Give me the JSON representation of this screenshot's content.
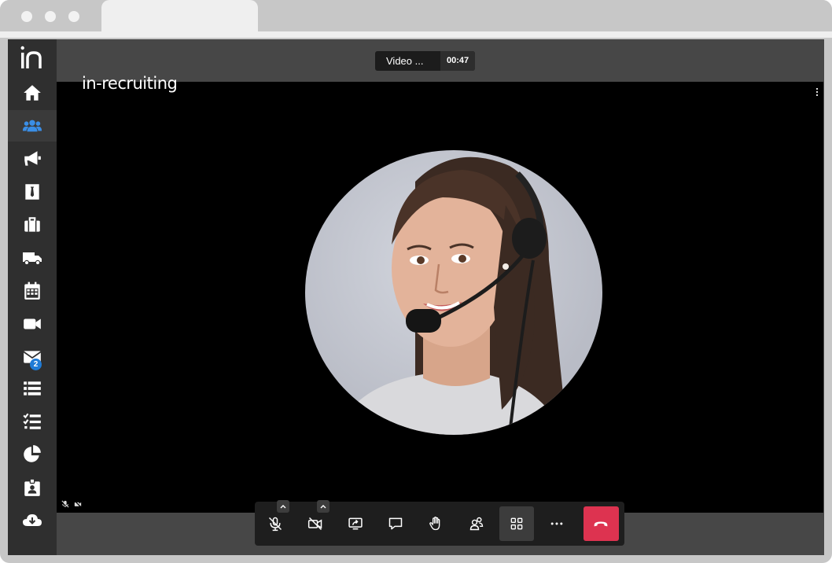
{
  "app": {
    "brand": "in-recruiting",
    "meeting_title": "Video ...",
    "elapsed": "00:47",
    "accent_color": "#1f7bd6",
    "hangup_color": "#dd3350"
  },
  "sidebar": {
    "items": [
      {
        "icon": "home-icon"
      },
      {
        "icon": "users-icon",
        "active": true
      },
      {
        "icon": "megaphone-icon"
      },
      {
        "icon": "id-card-icon"
      },
      {
        "icon": "briefcase-icon"
      },
      {
        "icon": "truck-icon"
      },
      {
        "icon": "calendar-icon"
      },
      {
        "icon": "video-icon"
      },
      {
        "icon": "mail-icon",
        "badge": "2"
      },
      {
        "icon": "list-icon"
      },
      {
        "icon": "checklist-icon"
      },
      {
        "icon": "pie-chart-icon"
      },
      {
        "icon": "badge-id-icon"
      },
      {
        "icon": "cloud-download-icon"
      }
    ]
  },
  "toolbar": {
    "buttons": [
      {
        "icon": "mic-off-icon",
        "has_menu": true
      },
      {
        "icon": "camera-off-icon",
        "has_menu": true
      },
      {
        "icon": "screen-share-icon"
      },
      {
        "icon": "chat-icon"
      },
      {
        "icon": "raise-hand-icon"
      },
      {
        "icon": "participants-icon"
      },
      {
        "icon": "tile-view-icon",
        "selected": true
      },
      {
        "icon": "more-icon"
      },
      {
        "icon": "hangup-icon"
      }
    ]
  }
}
